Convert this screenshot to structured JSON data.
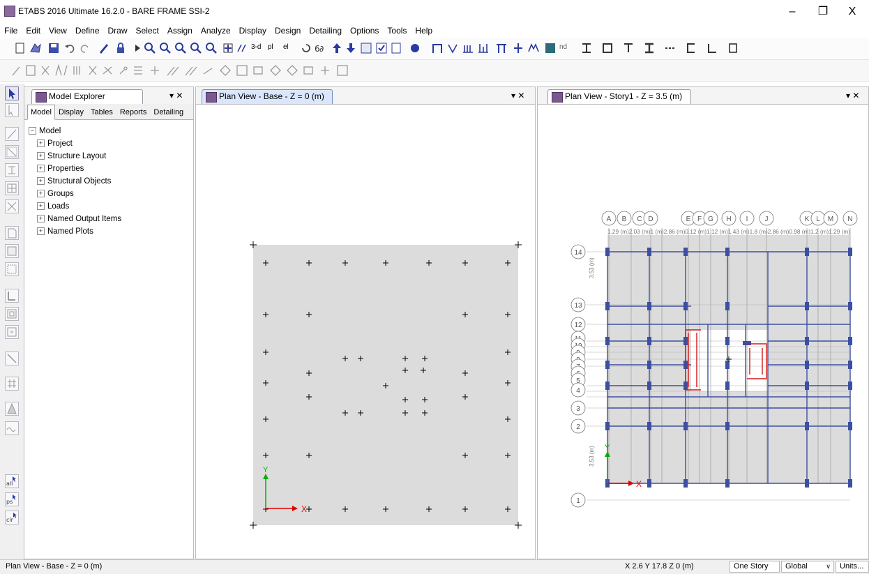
{
  "window": {
    "title": "ETABS 2016 Ultimate 16.2.0 - BARE FRAME SSI-2",
    "minimize": "–",
    "maximize": "❐",
    "close": "X"
  },
  "menu": [
    "File",
    "Edit",
    "View",
    "Define",
    "Draw",
    "Select",
    "Assign",
    "Analyze",
    "Display",
    "Design",
    "Detailing",
    "Options",
    "Tools",
    "Help"
  ],
  "toolbar": {
    "three_d_label": "3-d",
    "plan_label": "pl",
    "elev_label": "el",
    "nd_label": "nd"
  },
  "model_explorer": {
    "title": "Model Explorer",
    "close": "▾ ✕",
    "subtabs": [
      "Model",
      "Display",
      "Tables",
      "Reports",
      "Detailing"
    ],
    "tree_root": "Model",
    "tree_items": [
      "Project",
      "Structure Layout",
      "Properties",
      "Structural Objects",
      "Groups",
      "Loads",
      "Named Output Items",
      "Named Plots"
    ],
    "collapse_symbol": "−",
    "expand_symbol": "+"
  },
  "plan_base": {
    "title": "Plan View - Base - Z = 0 (m)",
    "close": "▾ ✕",
    "x_axis": "X",
    "y_axis": "Y"
  },
  "plan_story1": {
    "title": "Plan View - Story1 - Z = 3.5 (m)",
    "close": "▾ ✕",
    "x_axis": "X",
    "y_axis": "Y",
    "grid_letters": [
      "A",
      "B",
      "C",
      "D",
      "E",
      "F",
      "G",
      "H",
      "I",
      "J",
      "K",
      "L",
      "M",
      "N"
    ],
    "grid_numbers": [
      "14",
      "13",
      "12",
      "11",
      "10",
      "9",
      "8",
      "7",
      "6",
      "5",
      "4",
      "3",
      "2",
      "1"
    ],
    "dim_top": "1.29 (m)2.03 (m)1 (m)2.86 (m)0.12 (m)1.12 (m)1.43 (m)1.8 (m)2.86 (m)0.98 (m)1.2 (m)1.29 (m)",
    "dim_side_top": "3.53 (m)",
    "dim_side_bottom": "3.53 (m)"
  },
  "status": {
    "view": "Plan View - Base - Z = 0 (m)",
    "coords": "X 2.6  Y 17.8  Z 0 (m)",
    "story_select": "One Story",
    "coord_system": "Global",
    "units": "Units..."
  },
  "colors": {
    "accent": "#d9e6fb",
    "beam": "#3c4fa0",
    "wall": "#d01818",
    "axis_x": "#e00000",
    "axis_y": "#00b000"
  }
}
